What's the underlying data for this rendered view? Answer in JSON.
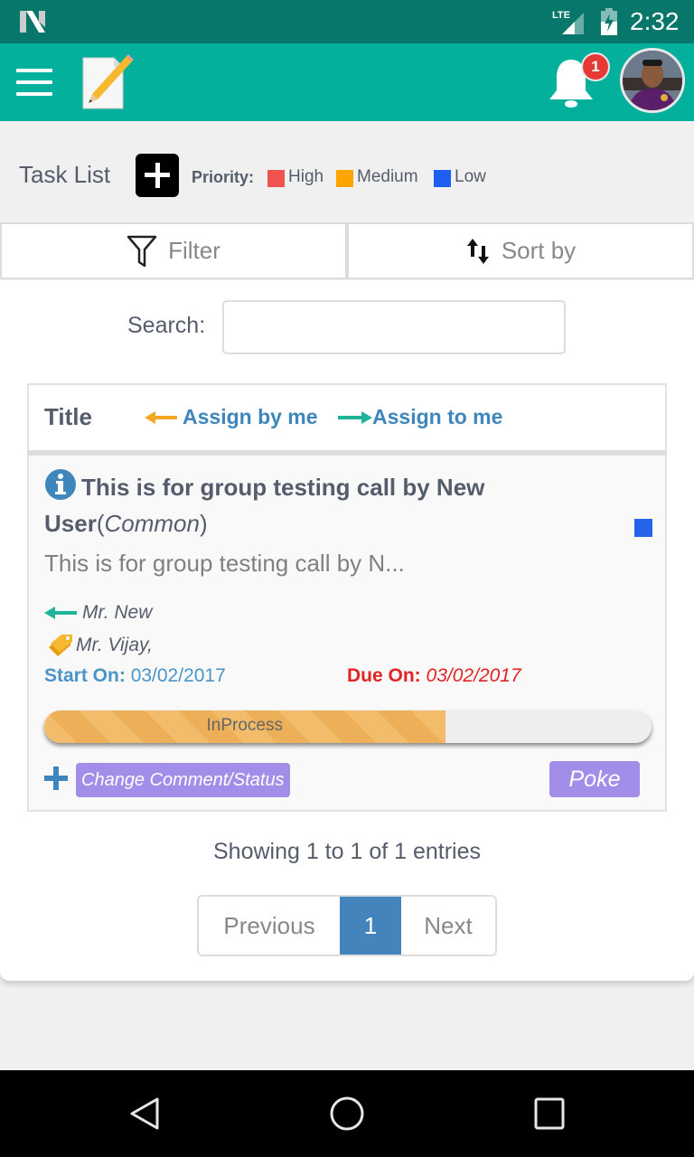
{
  "statusbar": {
    "time": "2:32",
    "network": "LTE"
  },
  "appbar": {
    "notification_count": "1"
  },
  "heading": {
    "title": "Task List",
    "priority_label": "Priority:",
    "legend": [
      {
        "label": "High",
        "color": "#ef5350"
      },
      {
        "label": "Medium",
        "color": "#ffa500"
      },
      {
        "label": "Low",
        "color": "#1e5ef0"
      }
    ]
  },
  "toolbar": {
    "filter_label": "Filter",
    "sort_label": "Sort by"
  },
  "search": {
    "label": "Search:",
    "value": "",
    "placeholder": ""
  },
  "table": {
    "header": {
      "title": "Title",
      "assign_by_me": "Assign by me",
      "assign_to_me": "Assign to me"
    },
    "rows": [
      {
        "title_line1": "This is for group testing call by New",
        "title_line2": "User",
        "group": "Common",
        "description": "This is for group testing call by N...",
        "priority_color": "#2563eb",
        "assigned_by": "Mr. New",
        "assigned_to": "Mr. Vijay,",
        "start_label": "Start On:",
        "start_date": "03/02/2017",
        "due_label": "Due On:",
        "due_date": "03/02/2017",
        "status": "InProcess",
        "progress_percent": 66,
        "change_label": "Change Comment/Status",
        "poke_label": "Poke"
      }
    ]
  },
  "footer": {
    "showing": "Showing 1 to 1 of 1 entries",
    "previous": "Previous",
    "current_page": "1",
    "next": "Next"
  }
}
